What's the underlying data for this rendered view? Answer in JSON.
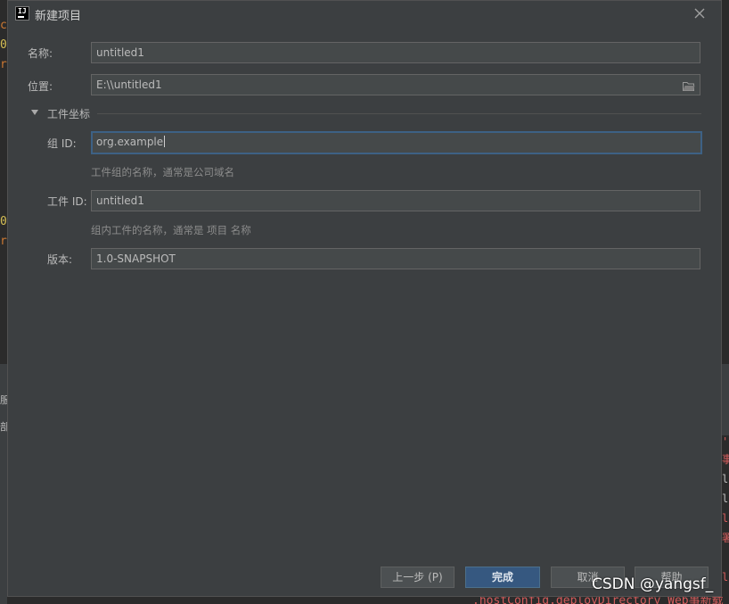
{
  "window": {
    "title": "新建项目",
    "app_icon_text": "IJ"
  },
  "form": {
    "name_label": "名称:",
    "name_value": "untitled1",
    "location_label": "位置:",
    "location_value": "E:\\\\untitled1"
  },
  "artifact_section": {
    "title": "工件坐标",
    "group_id_label": "组 ID:",
    "group_id_value": "org.example",
    "group_id_hint": "工件组的名称，通常是公司域名",
    "artifact_id_label": "工件 ID:",
    "artifact_id_value": "untitled1",
    "artifact_id_hint": "组内工件的名称，通常是 项目 名称",
    "version_label": "版本:",
    "version_value": "1.0-SNAPSHOT"
  },
  "buttons": {
    "previous": "上一步 (P)",
    "finish": "完成",
    "cancel": "取消",
    "help": "帮助"
  },
  "background": {
    "left_fragments": [
      "c",
      "0'",
      "r",
      "0'",
      "r"
    ],
    "left_panel_fragments": [
      "服",
      "部"
    ],
    "right_fragments": [
      "'",
      "事",
      "l",
      "l",
      "l",
      "署",
      "l"
    ],
    "bottom_code": ".hostConfig.deployDirectory Web事新载"
  },
  "watermark": "CSDN @yangsf_",
  "colors": {
    "dialog_bg": "#3c3f41",
    "field_bg": "#45494a",
    "focus_border": "#3d6185",
    "primary_button": "#365880",
    "code_orange": "#cc7832",
    "code_yellow": "#d6bf55",
    "code_red": "#d35b5b"
  }
}
